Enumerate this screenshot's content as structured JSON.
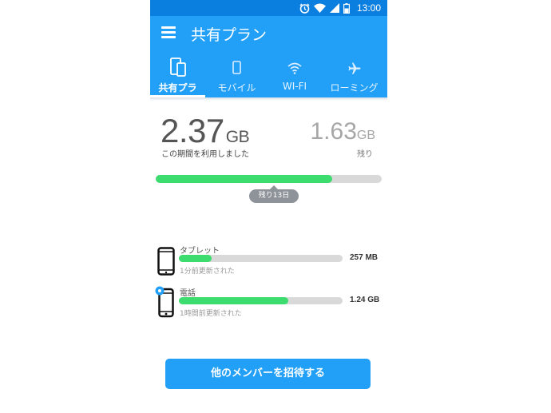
{
  "status_bar": {
    "time": "13:00"
  },
  "app_bar": {
    "title": "共有プラン",
    "menu_icon": "hamburger-menu-icon"
  },
  "tabs": [
    {
      "label": "共有プラ",
      "icon": "devices-icon",
      "active": true
    },
    {
      "label": "モバイル",
      "icon": "phone-icon",
      "active": false
    },
    {
      "label": "WI-FI",
      "icon": "wifi-icon",
      "active": false
    },
    {
      "label": "ローミング",
      "icon": "airplane-icon",
      "active": false
    }
  ],
  "usage": {
    "used_value": "2.37",
    "used_unit": "GB",
    "used_caption": "この期間を利用しました",
    "remaining_value": "1.63",
    "remaining_unit": "GB",
    "remaining_caption": "残り",
    "progress_fraction": 0.78,
    "days_left": "残り13日"
  },
  "devices": [
    {
      "name": "タブレット",
      "size": "257 MB",
      "updated": "1分前更新された",
      "fill_fraction": 0.2,
      "icon": "tablet-icon"
    },
    {
      "name": "電話",
      "size": "1.24 GB",
      "updated": "1時間前更新された",
      "fill_fraction": 0.67,
      "icon": "phone-icon",
      "badge_icon": "gear-icon"
    }
  ],
  "invite_button": {
    "label": "他のメンバーを招待する"
  },
  "colors": {
    "primary": "#22a0f7",
    "statusbar": "#0b7fe0",
    "progress": "#3ddc6f",
    "track": "#d9d9d9",
    "badge": "#8e9399"
  }
}
